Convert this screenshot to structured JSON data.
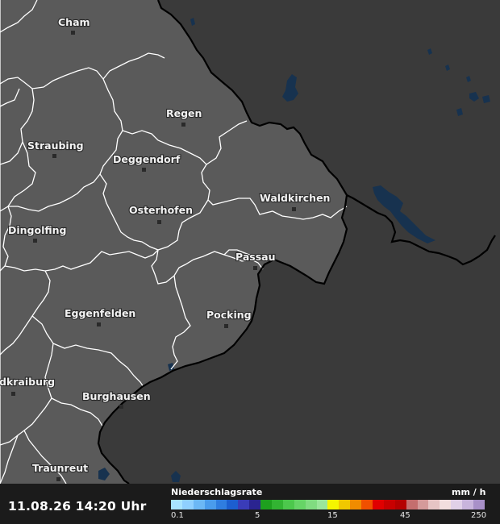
{
  "map": {
    "cities": [
      {
        "name": "Cham"
      },
      {
        "name": "Regen"
      },
      {
        "name": "Straubing"
      },
      {
        "name": "Deggendorf"
      },
      {
        "name": "Waldkirchen"
      },
      {
        "name": "Osterhofen"
      },
      {
        "name": "Dingolfing"
      },
      {
        "name": "Passau"
      },
      {
        "name": "Eggenfelden"
      },
      {
        "name": "Pocking"
      },
      {
        "name": "dkraiburg"
      },
      {
        "name": "Burghausen"
      },
      {
        "name": "Traunreut"
      }
    ],
    "colors": {
      "region_fill": "#5a5a5a",
      "outside_fill": "#3a3a3a",
      "water": "#17324f",
      "district_border": "#ffffff",
      "country_border": "#000000"
    }
  },
  "footer": {
    "timestamp": "11.08.26 14:20 Uhr",
    "legend_title": "Niederschlagsrate",
    "legend_unit": "mm / h",
    "legend_ticks": [
      "0.1",
      "5",
      "15",
      "45",
      "250"
    ],
    "legend_colors": [
      "#a8e4ff",
      "#8fd0ff",
      "#6cb8f5",
      "#4a9cec",
      "#2f7de0",
      "#1c5ed0",
      "#3a3cb8",
      "#2a2490",
      "#1ea01e",
      "#32b432",
      "#4cc84c",
      "#66d466",
      "#80dc80",
      "#9ae69a",
      "#f5f500",
      "#f0c800",
      "#f08c00",
      "#f05000",
      "#e00000",
      "#c80000",
      "#b40000",
      "#c46e6e",
      "#d49a9a",
      "#e6c4c4",
      "#f2dede",
      "#e0d0e8",
      "#c8b4dc",
      "#a890c8"
    ]
  }
}
